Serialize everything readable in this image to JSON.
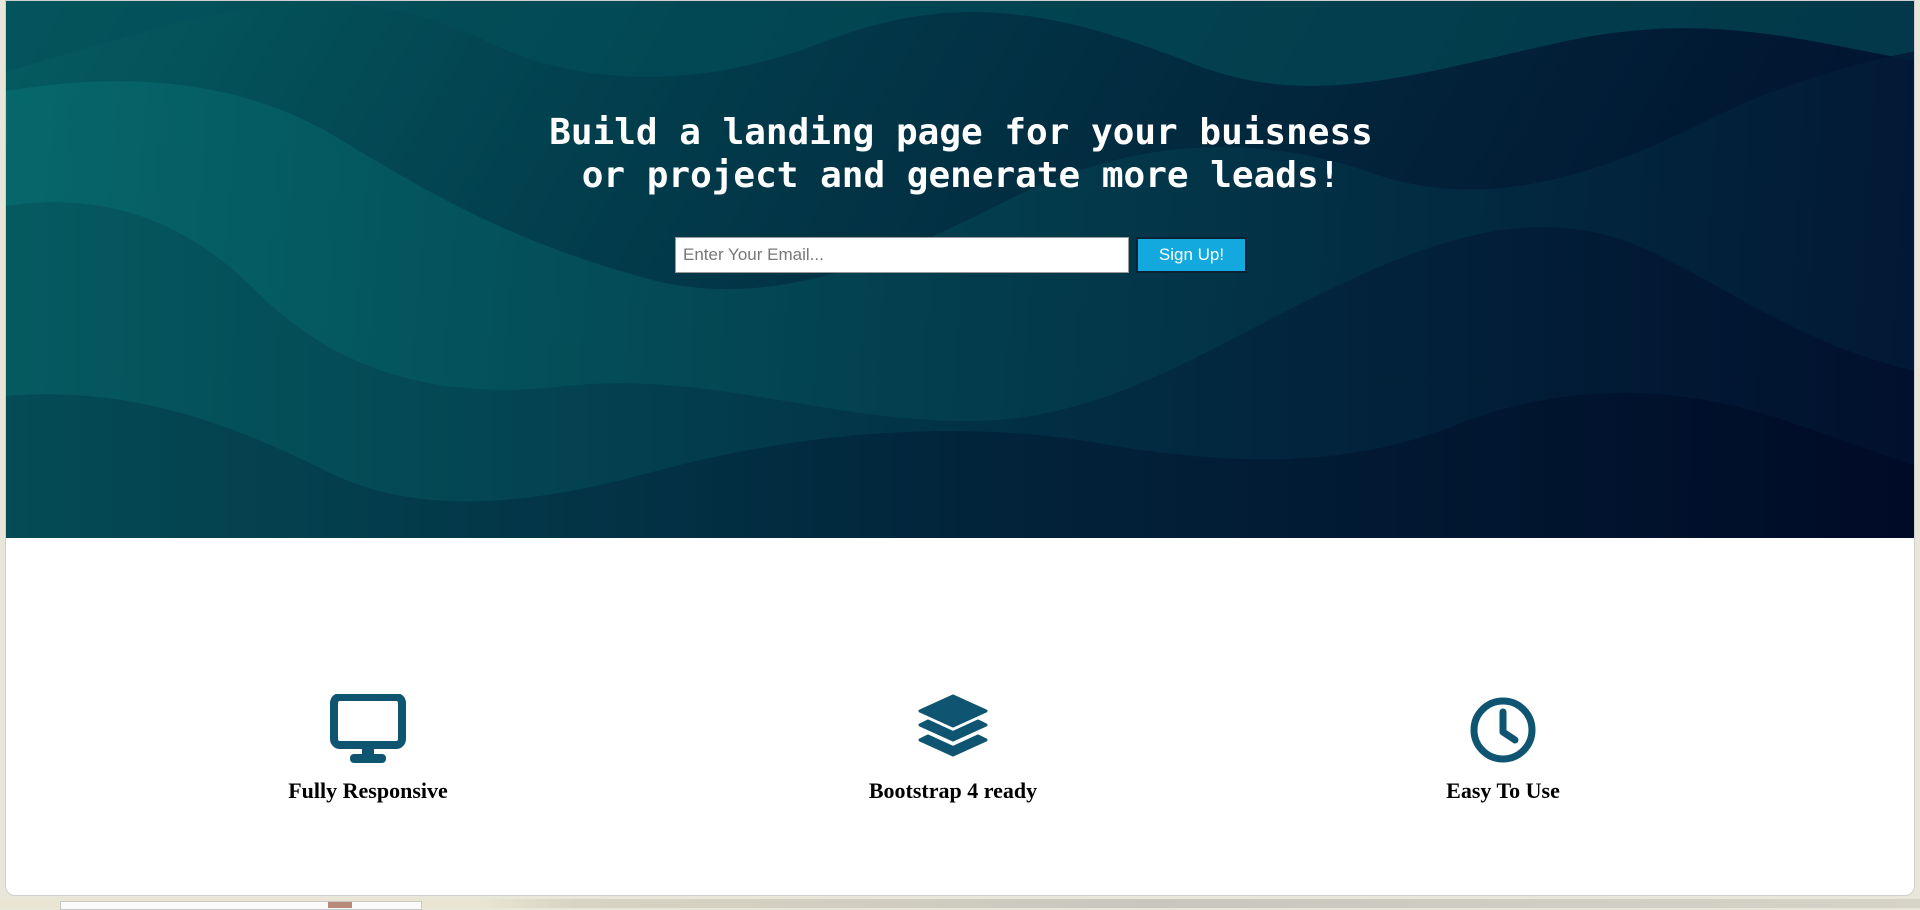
{
  "hero": {
    "title_line1": "Build a landing page for your buisness",
    "title_line2": "or project and generate more leads!",
    "email_placeholder": "Enter Your Email...",
    "signup_label": "Sign Up!"
  },
  "features": [
    {
      "icon": "monitor-icon",
      "label": "Fully Responsive"
    },
    {
      "icon": "layers-icon",
      "label": "Bootstrap 4 ready"
    },
    {
      "icon": "clock-icon",
      "label": "Easy To Use"
    }
  ],
  "colors": {
    "hero_dark": "#000c2a",
    "hero_teal": "#045c60",
    "button_bg": "#13a9df",
    "icon_color": "#0f5470"
  }
}
